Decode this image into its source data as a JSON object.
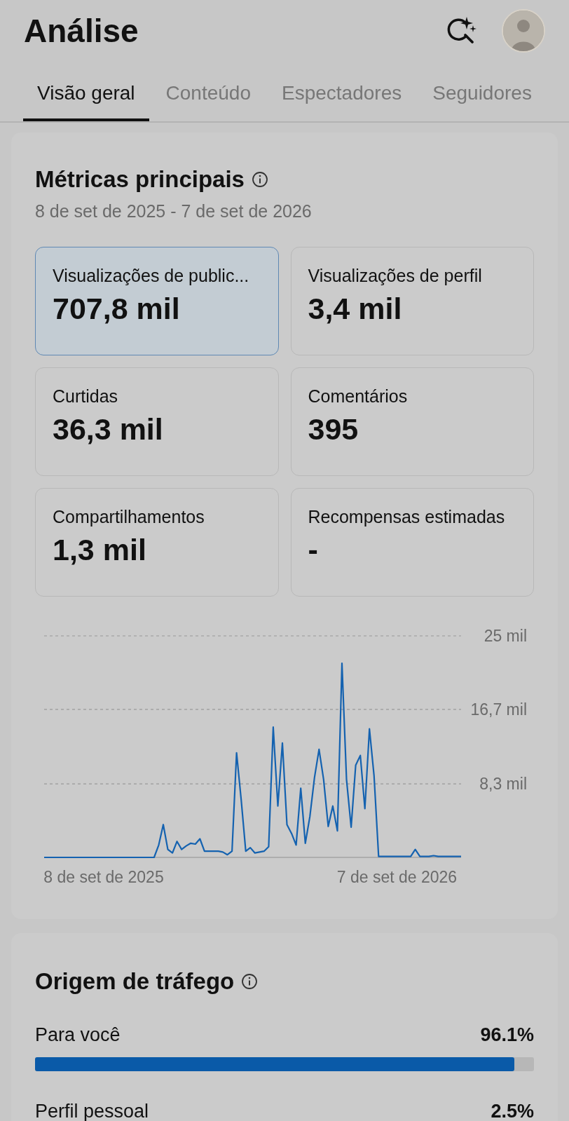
{
  "header": {
    "title": "Análise"
  },
  "tabs": [
    {
      "label": "Visão geral",
      "selected": true
    },
    {
      "label": "Conteúdo",
      "selected": false
    },
    {
      "label": "Espectadores",
      "selected": false
    },
    {
      "label": "Seguidores",
      "selected": false
    }
  ],
  "key_metrics": {
    "title": "Métricas principais",
    "date_range": "8 de set de 2025 - 7 de set de 2026",
    "metrics": [
      {
        "label": "Visualizações de public...",
        "value": "707,8 mil",
        "selected": true
      },
      {
        "label": "Visualizações de perfil",
        "value": "3,4 mil",
        "selected": false
      },
      {
        "label": "Curtidas",
        "value": "36,3 mil",
        "selected": false
      },
      {
        "label": "Comentários",
        "value": "395",
        "selected": false
      },
      {
        "label": "Compartilhamentos",
        "value": "1,3 mil",
        "selected": false
      },
      {
        "label": "Recompensas estimadas",
        "value": "-",
        "selected": false
      }
    ],
    "chart_data": {
      "type": "line",
      "categories": [
        null,
        null,
        null,
        null,
        null,
        null,
        null,
        null,
        null,
        null,
        null,
        null,
        null,
        "8 de set de 2025",
        null,
        null,
        null,
        null,
        null,
        null,
        null,
        null,
        null,
        null,
        null,
        null,
        null,
        null,
        null,
        null,
        null,
        null,
        null,
        null,
        null,
        null,
        null,
        null,
        null,
        null,
        null,
        null,
        null,
        null,
        null,
        null,
        null,
        null,
        null,
        null,
        null,
        null,
        null,
        null,
        null,
        null,
        null,
        null,
        null,
        null,
        null,
        null,
        null,
        null,
        null,
        null,
        null,
        null,
        null,
        null,
        null,
        null,
        null,
        null,
        null,
        null,
        null,
        "7 de set de 2026",
        null,
        null,
        null,
        null,
        null,
        null,
        null,
        null,
        null,
        null,
        null,
        null,
        null,
        null
      ],
      "series": [
        {
          "color": "#1462b0",
          "values": [
            0,
            0,
            0,
            0,
            0,
            0,
            0,
            0,
            0,
            0,
            0,
            0,
            0,
            0,
            0,
            0,
            0,
            0,
            0,
            0,
            0,
            0,
            0,
            0,
            0,
            1.4,
            3.7,
            0.9,
            0.5,
            1.8,
            0.9,
            1.3,
            1.6,
            1.5,
            2.1,
            0.7,
            0.7,
            0.7,
            0.7,
            0.6,
            0.3,
            0.7,
            11.8,
            6.5,
            0.7,
            1.1,
            0.5,
            0.6,
            0.7,
            1.2,
            14.7,
            5.8,
            12.9,
            3.7,
            2.7,
            1.4,
            7.8,
            1.6,
            4.6,
            9.0,
            12.2,
            8.8,
            3.5,
            5.8,
            3.0,
            21.9,
            8.8,
            3.4,
            10.4,
            11.5,
            5.5,
            14.5,
            9.2,
            0.1,
            0.1,
            0.1,
            0.1,
            0.1,
            0.1,
            0.1,
            0.1,
            0.9,
            0.1,
            0.1,
            0.1,
            0.2,
            0.1,
            0.1,
            0.1,
            0.1,
            0.1,
            0.1
          ]
        }
      ],
      "ylim": [
        0,
        25
      ],
      "yticks": [
        {
          "value": 25,
          "label": "25 mil"
        },
        {
          "value": 16.7,
          "label": "16,7 mil"
        },
        {
          "value": 8.3,
          "label": "8,3 mil"
        }
      ]
    }
  },
  "traffic": {
    "title": "Origem de tráfego",
    "items": [
      {
        "label": "Para você",
        "value": "96.1%",
        "level": 0.961
      },
      {
        "label": "Perfil pessoal",
        "value": "2.5%"
      }
    ]
  }
}
